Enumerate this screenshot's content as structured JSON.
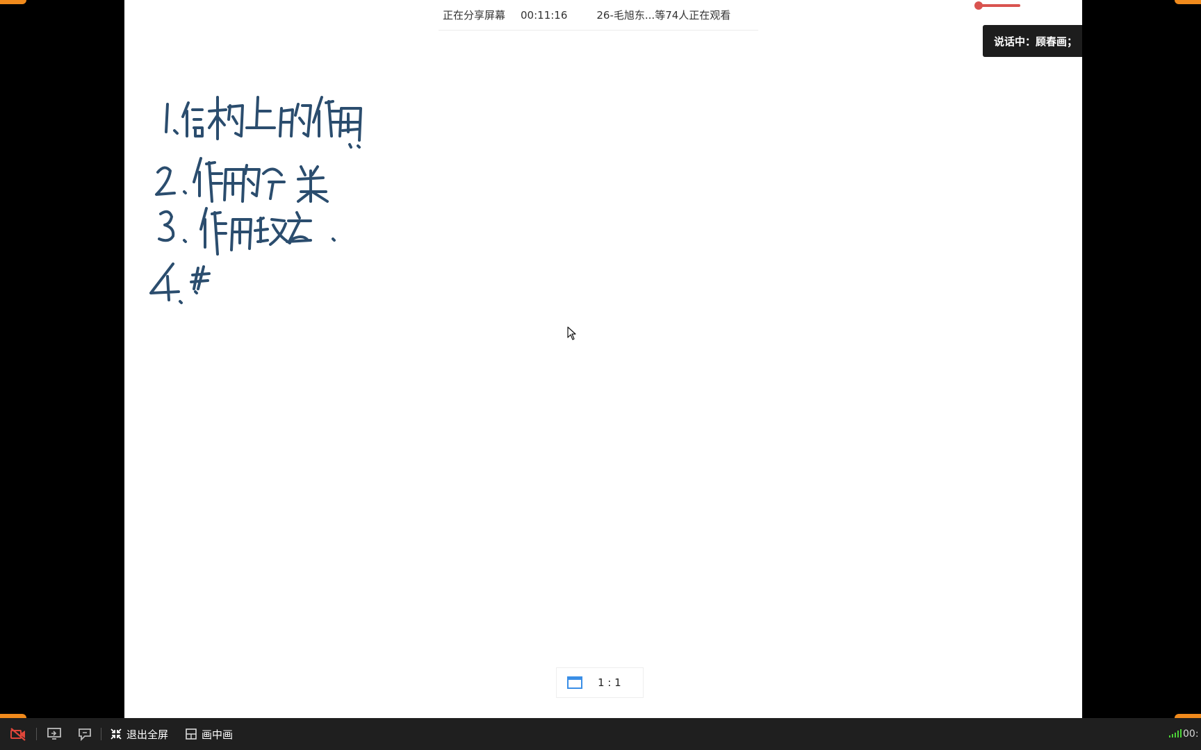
{
  "share_bar": {
    "status": "正在分享屏幕",
    "duration": "00:11:16",
    "viewers": "26-毛旭东...等74人正在观看"
  },
  "speaking": {
    "label": "说话中：顾春画；"
  },
  "whiteboard": {
    "lines": [
      "1. 结构上的作用",
      "2. 作用的分类",
      "3. 作用效应",
      "4. #"
    ]
  },
  "ratio": {
    "label": "1 : 1"
  },
  "taskbar": {
    "exit_fullscreen": "退出全屏",
    "pip": "画中画",
    "clock_fragment": "00:"
  },
  "colors": {
    "ink": "#2b4d6e",
    "accent": "#f08a1c",
    "camera_off": "#e0463a"
  }
}
